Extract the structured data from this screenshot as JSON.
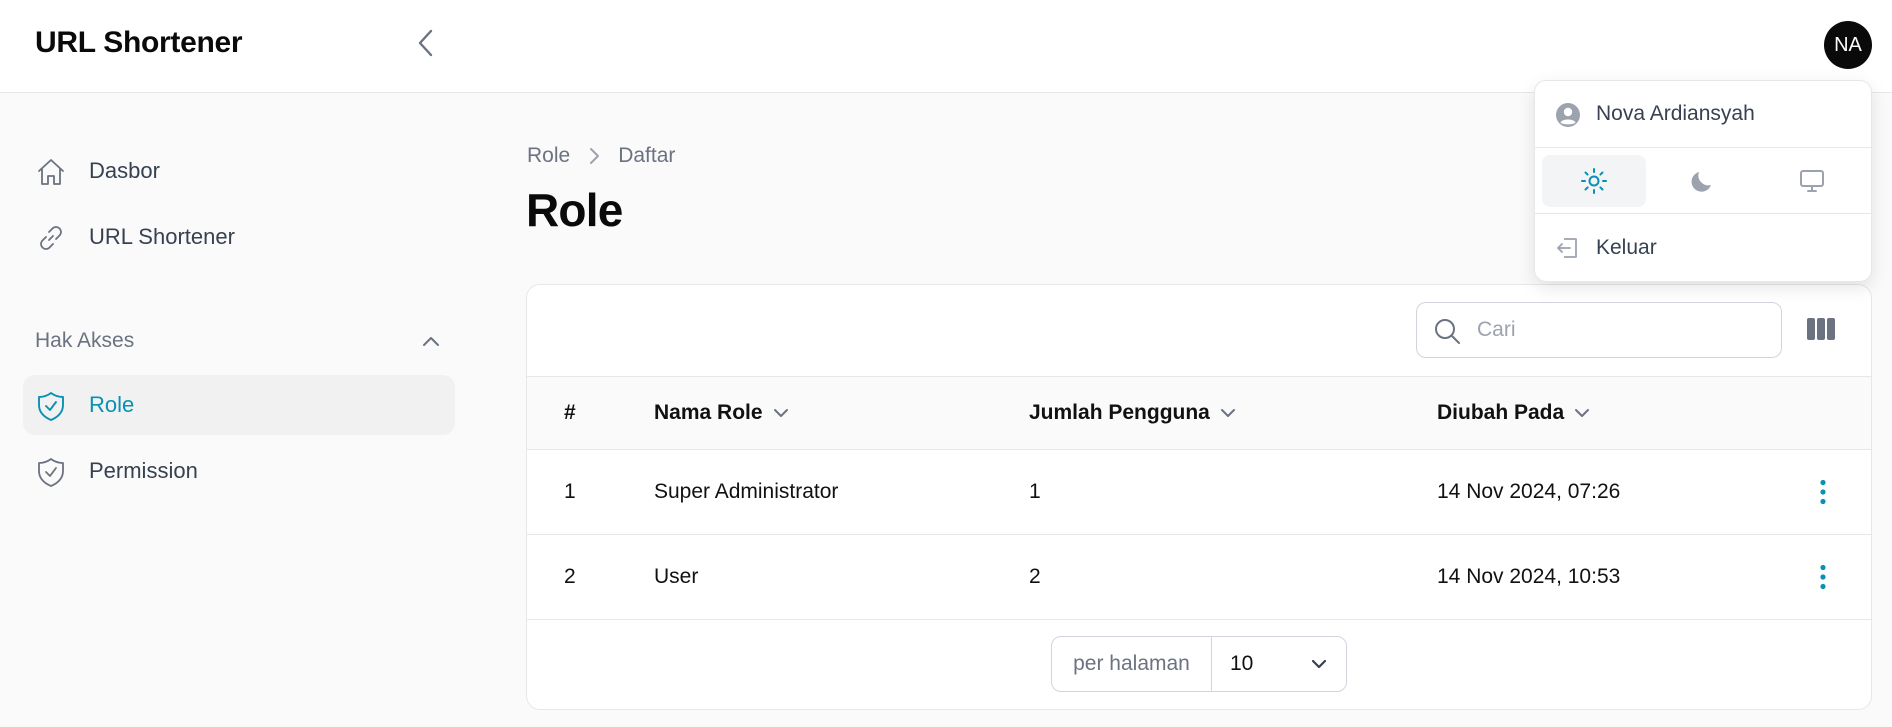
{
  "header": {
    "brand": "URL Shortener",
    "avatar_initials": "NA"
  },
  "sidebar": {
    "items": [
      {
        "label": "Dasbor",
        "icon": "home-icon"
      },
      {
        "label": "URL Shortener",
        "icon": "link-icon"
      }
    ],
    "group": {
      "label": "Hak Akses",
      "items": [
        {
          "label": "Role",
          "icon": "shield-check-icon",
          "active": true
        },
        {
          "label": "Permission",
          "icon": "shield-check-icon",
          "active": false
        }
      ]
    }
  },
  "breadcrumb": {
    "parent": "Role",
    "current": "Daftar"
  },
  "page": {
    "title": "Role"
  },
  "table": {
    "search_placeholder": "Cari",
    "search_value": "",
    "columns": [
      "#",
      "Nama Role",
      "Jumlah Pengguna",
      "Diubah Pada"
    ],
    "rows": [
      {
        "no": "1",
        "name": "Super Administrator",
        "users": "1",
        "updated": "14 Nov 2024, 07:26"
      },
      {
        "no": "2",
        "name": "User",
        "users": "2",
        "updated": "14 Nov 2024, 10:53"
      }
    ],
    "pagination": {
      "per_page_label": "per halaman",
      "per_page_value": "10"
    }
  },
  "user_menu": {
    "name": "Nova Ardiansyah",
    "theme_options": [
      "light",
      "dark",
      "system"
    ],
    "theme_selected": "light",
    "logout_label": "Keluar"
  },
  "colors": {
    "accent": "#0891b2",
    "avatar_bg": "#0a0a0a"
  }
}
